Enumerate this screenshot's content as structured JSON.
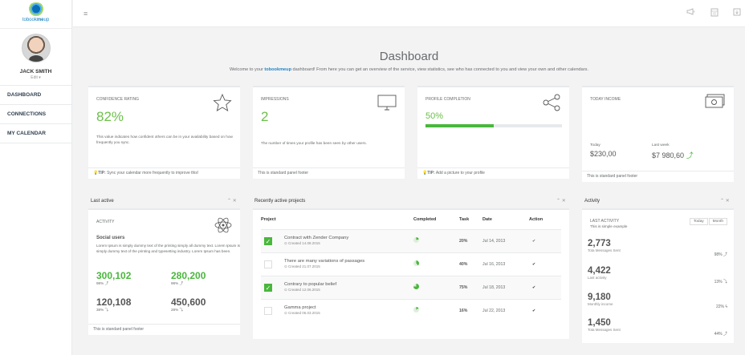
{
  "app": {
    "logo_text_1": "tobook",
    "logo_text_2": "me",
    "logo_text_3": "up"
  },
  "profile": {
    "name": "JACK SMITH",
    "edit": "Edit ▾"
  },
  "nav": [
    {
      "label": "DASHBOARD"
    },
    {
      "label": "CONNECTIONS"
    },
    {
      "label": "MY CALENDAR"
    }
  ],
  "topbar": {
    "menu_icon": "≡",
    "icons": [
      "megaphone-icon",
      "calendar-icon",
      "exit-icon"
    ]
  },
  "header": {
    "title": "Dashboard",
    "welcome_pre": "Welcome to your ",
    "welcome_brand": "tobookmeup",
    "welcome_post": " dashboard! From here you can get an overview of the service, view statistics, see who has connected to you and view your own and other calendars."
  },
  "cards": {
    "confidence": {
      "label": "CONFIDENCE RATING",
      "value": "82%",
      "desc": "This value indicates how confident others can be in your availability based on how frequently you sync.",
      "tip_label": "TIP:",
      "tip": "Sync your calendar more frequently to improve this!"
    },
    "impressions": {
      "label": "IMPRESSIONS",
      "value": "2",
      "desc": "The number of times your profile has been seen by other users.",
      "footer": "This is standard panel footer"
    },
    "profile_completion": {
      "label": "PROFILE COMPLETION",
      "value": "50%",
      "progress": 0.5,
      "tip_label": "TIP:",
      "tip": "Add a picture to your profile"
    },
    "income": {
      "label": "TODAY INCOME",
      "today_label": "Today",
      "today_value": "$230,00",
      "week_label": "Last week",
      "week_value": "$7 980,60",
      "footer": "This is standard panel footer"
    }
  },
  "last_active": {
    "title": "Last active",
    "sub_label": "ACTIVITY",
    "heading": "Social users",
    "body": "Lorem Ipsum is simply dummy text of the printing simply all dummy text. Lorem Ipsum is simply dummy text of the printing and typesetting industry. Lorem Ipsum has been.",
    "stats": [
      {
        "value": "300,102",
        "pct": "98% ⤴"
      },
      {
        "value": "280,200",
        "pct": "98% ⤴"
      },
      {
        "value": "120,108",
        "pct": "38% ⤵"
      },
      {
        "value": "450,600",
        "pct": "28% ⤵"
      }
    ],
    "footer": "This is standard panel footer"
  },
  "projects": {
    "title": "Recently active projects",
    "headers": [
      "Project",
      "Completed",
      "Task",
      "Date",
      "Action"
    ],
    "rows": [
      {
        "checked": true,
        "name": "Contract with Zender Company",
        "created": "Created 14.08.2015",
        "completed": 0.2,
        "task": "20%",
        "date": "Jul 14, 2013",
        "action": "✔"
      },
      {
        "checked": false,
        "name": "There are many variations of passages",
        "created": "Created 21.07.2015",
        "completed": 0.4,
        "task": "40%",
        "date": "Jul 16, 2013",
        "action": "✔"
      },
      {
        "checked": true,
        "name": "Contrary to popular belief",
        "created": "Created 12.06.2015",
        "completed": 0.75,
        "task": "75%",
        "date": "Jul 18, 2013",
        "action": "✔"
      },
      {
        "checked": false,
        "name": "Gamma project",
        "created": "Created 06.03.2015",
        "completed": 0.16,
        "task": "16%",
        "date": "Jul 22, 2013",
        "action": "✔"
      }
    ]
  },
  "activity": {
    "title": "Activity",
    "sub_label": "LAST ACTIVITY",
    "sub_desc": "This is simple example",
    "btn_today": "Today",
    "btn_month": "Month",
    "stats": [
      {
        "value": "2,773",
        "label": "Tota Messages Sent",
        "pct": "98% ⤴",
        "green": true
      },
      {
        "value": "4,422",
        "label": "Last activity",
        "pct": "13% ⤵",
        "green": false
      },
      {
        "value": "9,180",
        "label": "Monthly income",
        "pct": "22% ϟ",
        "green": false
      },
      {
        "value": "1,450",
        "label": "Tota Messages Sent",
        "pct": "44% ⤴",
        "green": true
      }
    ]
  },
  "colors": {
    "accent_green": "#49b73c",
    "brand_blue": "#1c84c6",
    "background": "#f3f3f4"
  }
}
